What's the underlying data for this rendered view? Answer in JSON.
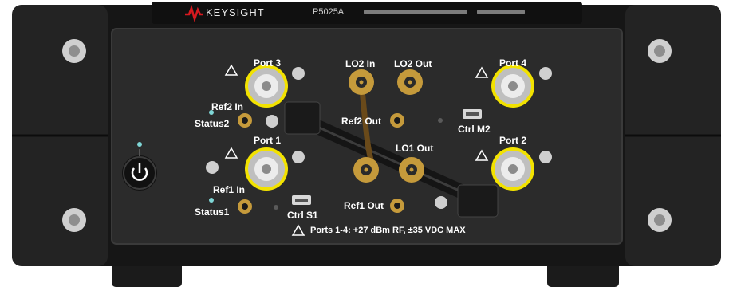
{
  "brand": {
    "name": "KEYSIGHT",
    "model": "P5025A",
    "logo_icon": "keysight-wave-logo-icon",
    "accent_color": "#d7191f"
  },
  "ports": {
    "port3": "Port 3",
    "port1": "Port 1",
    "port4": "Port 4",
    "port2": "Port 2"
  },
  "connectors": {
    "lo2_in": "LO2 In",
    "lo2_out": "LO2 Out",
    "ref2_in": "Ref2 In",
    "ref2_out": "Ref2 Out",
    "ref1_in": "Ref1 In",
    "ref1_out": "Ref1 Out",
    "lo1_out": "LO1 Out",
    "ctrl_m2": "Ctrl M2",
    "ctrl_s1": "Ctrl S1"
  },
  "status": {
    "status1": "Status1",
    "status2": "Status2",
    "led_color": "#7fd6d6"
  },
  "warning": {
    "icon": "warning-triangle-icon",
    "text": "Ports 1-4: +27 dBm RF, ±35 VDC MAX"
  },
  "power": {
    "icon": "power-icon"
  },
  "colors": {
    "panel": "#2c2c2c",
    "frame": "#1a1a1a",
    "port_ring": "#f2e200",
    "brass": "#c59a3b",
    "cable": "#6a4a1a"
  }
}
